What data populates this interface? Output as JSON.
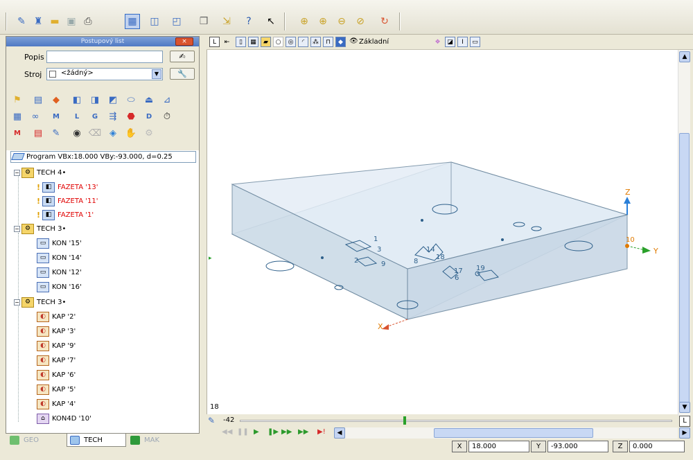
{
  "panel": {
    "title": "Postupový list",
    "close": "×",
    "popis_label": "Popis",
    "popis_value": "",
    "stroj_label": "Stroj",
    "stroj_value": "<žádný>",
    "program_text": "Program VBx:18.000 VBy:-93.000, d=0.25"
  },
  "tree": {
    "tech4": "TECH 4•",
    "fazeta": [
      "FAZETA '13'",
      "FAZETA '11'",
      "FAZETA '1'"
    ],
    "tech3a": "TECH 3•",
    "kon": [
      "KON '15'",
      "KON '14'",
      "KON '12'",
      "KON '16'"
    ],
    "tech3b": "TECH 3•",
    "kap": [
      "KAP '2'",
      "KAP '3'",
      "KAP '9'",
      "KAP '7'",
      "KAP '6'",
      "KAP '5'",
      "KAP '4'"
    ],
    "kon4d": "KON4D '10'"
  },
  "tabs": {
    "geo": "GEO",
    "tech": "TECH",
    "mak": "MAK"
  },
  "view_toolbar": {
    "mode_label": "Základní",
    "l_button": "L"
  },
  "viewport": {
    "axis_z": "Z",
    "axis_y": "Y",
    "axis_x": "X",
    "labels": [
      "1",
      "3",
      "2",
      "9",
      "14",
      "8",
      "18",
      "17",
      "6",
      "19",
      "10"
    ],
    "left_marker": "18"
  },
  "timeline": {
    "value": "-42"
  },
  "status": {
    "x_label": "X",
    "x_value": "18.000",
    "y_label": "Y",
    "y_value": "-93.000",
    "z_label": "Z",
    "z_value": "0.000"
  },
  "scroll": {
    "corner": "L"
  },
  "icons": {
    "toolbar": [
      "edit-icon",
      "robot-icon",
      "folder-icon",
      "save-icon",
      "print-icon",
      "window-icon",
      "zoom-window-icon",
      "zoom-fit-icon",
      "cube-icon",
      "export-icon",
      "help-icon",
      "whats-this-icon",
      "zoom-icon",
      "zoom-in-icon",
      "zoom-out-icon",
      "zoom-previous-icon",
      "refresh-icon"
    ]
  }
}
